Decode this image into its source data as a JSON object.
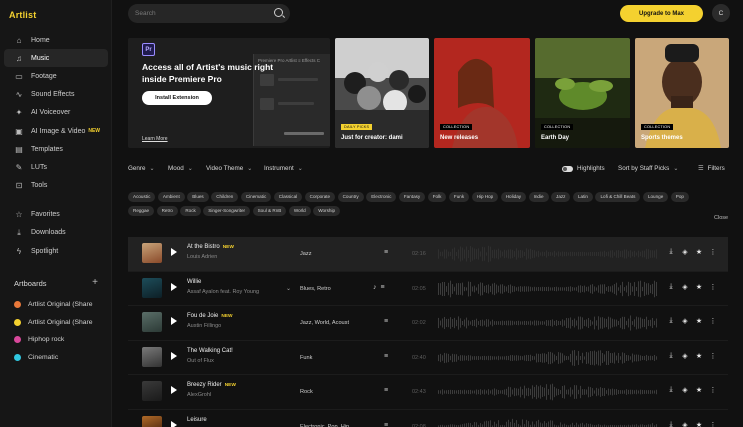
{
  "app": {
    "logo": "Artlist"
  },
  "sidebar": {
    "items": [
      {
        "icon": "home-icon",
        "glyph": "⌂",
        "label": "Home"
      },
      {
        "icon": "music-icon",
        "glyph": "♫",
        "label": "Music",
        "active": true
      },
      {
        "icon": "footage-icon",
        "glyph": "▭",
        "label": "Footage"
      },
      {
        "icon": "sound-effects-icon",
        "glyph": "∿",
        "label": "Sound Effects"
      },
      {
        "icon": "voiceover-icon",
        "glyph": "✦",
        "label": "AI Voiceover"
      },
      {
        "icon": "ai-image-icon",
        "glyph": "▣",
        "label": "AI Image & Video",
        "badge": "NEW"
      },
      {
        "icon": "templates-icon",
        "glyph": "▤",
        "label": "Templates"
      },
      {
        "icon": "luts-icon",
        "glyph": "✎",
        "label": "LUTs"
      },
      {
        "icon": "tools-icon",
        "glyph": "⊡",
        "label": "Tools"
      }
    ],
    "secondary": [
      {
        "icon": "star-icon",
        "glyph": "☆",
        "label": "Favorites"
      },
      {
        "icon": "download-icon",
        "glyph": "⤓",
        "label": "Downloads"
      },
      {
        "icon": "spotlight-icon",
        "glyph": "ϟ",
        "label": "Spotlight"
      }
    ],
    "artboards_title": "Artboards",
    "artboards": [
      {
        "label": "Artlist Original (Share",
        "color": "#e8783a"
      },
      {
        "label": "Artlist Original (Share",
        "color": "#f4d12f"
      },
      {
        "label": "Hiphop rock",
        "color": "#d9489b"
      },
      {
        "label": "Cinematic",
        "color": "#30c7e0"
      }
    ]
  },
  "topbar": {
    "search_placeholder": "Search",
    "upgrade_label": "Upgrade to Max",
    "avatar_initial": "C"
  },
  "promo": {
    "badge": "Pr",
    "title": "Access all of Artist's music right inside Premiere Pro",
    "install_label": "Install Extension",
    "learn_more": "Learn More",
    "preview_tabs": "Premiere Pro   Artlist  ≡   Effects C"
  },
  "hero_cards": [
    {
      "tag": "DAILY PICKS",
      "title": "Just for creator: dami"
    },
    {
      "tag": "COLLECTION",
      "title": "New releases"
    },
    {
      "tag": "COLLECTION",
      "title": "Earth Day"
    },
    {
      "tag": "COLLECTION",
      "title": "Sports themes"
    }
  ],
  "filters": {
    "genre": "Genre",
    "mood": "Mood",
    "video_theme": "Video Theme",
    "instrument": "Instrument",
    "highlights": "Highlights",
    "sort": "Sort by Staff Picks",
    "filters_label": "Filters"
  },
  "genres": [
    "Acoustic",
    "Ambient",
    "Blues",
    "Children",
    "Cinematic",
    "Classical",
    "Corporate",
    "Country",
    "Electronic",
    "Fantasy",
    "Folk",
    "Funk",
    "Hip Hop",
    "Holiday",
    "Indie",
    "Jazz",
    "Latin",
    "Lofi & Chill Beats",
    "Lounge",
    "Pop",
    "Reggae",
    "Retro",
    "Rock",
    "Singer-Songwriter",
    "Soul & RnB",
    "World",
    "Worship"
  ],
  "close_label": "Close",
  "tracks": [
    {
      "title": "At the Bistro",
      "new": "NEW",
      "artist": "Louis Adrien",
      "genre": "Jazz",
      "duration": "02:16",
      "has_stems": false,
      "has_chevron": false
    },
    {
      "title": "Willie",
      "new": "",
      "artist": "Assaf Ayalon feat. Roy Young",
      "genre": "Blues, Retro",
      "duration": "02:05",
      "has_stems": true,
      "has_chevron": true
    },
    {
      "title": "Fou de Joie",
      "new": "NEW",
      "artist": "Austin Fillingo",
      "genre": "Jazz, World, Acoust",
      "duration": "02:02",
      "has_stems": false,
      "has_chevron": false
    },
    {
      "title": "The Walking Cat!",
      "new": "",
      "artist": "Out of Flux",
      "genre": "Funk",
      "duration": "02:40",
      "has_stems": false,
      "has_chevron": false
    },
    {
      "title": "Breezy Rider",
      "new": "NEW",
      "artist": "AlexGrohl",
      "genre": "Rock",
      "duration": "02:43",
      "has_stems": false,
      "has_chevron": false
    },
    {
      "title": "Leisure",
      "new": "",
      "artist": "SAFSounds",
      "genre": "Electronic, Pop, Hip",
      "duration": "02:08",
      "has_stems": false,
      "has_chevron": false
    }
  ]
}
